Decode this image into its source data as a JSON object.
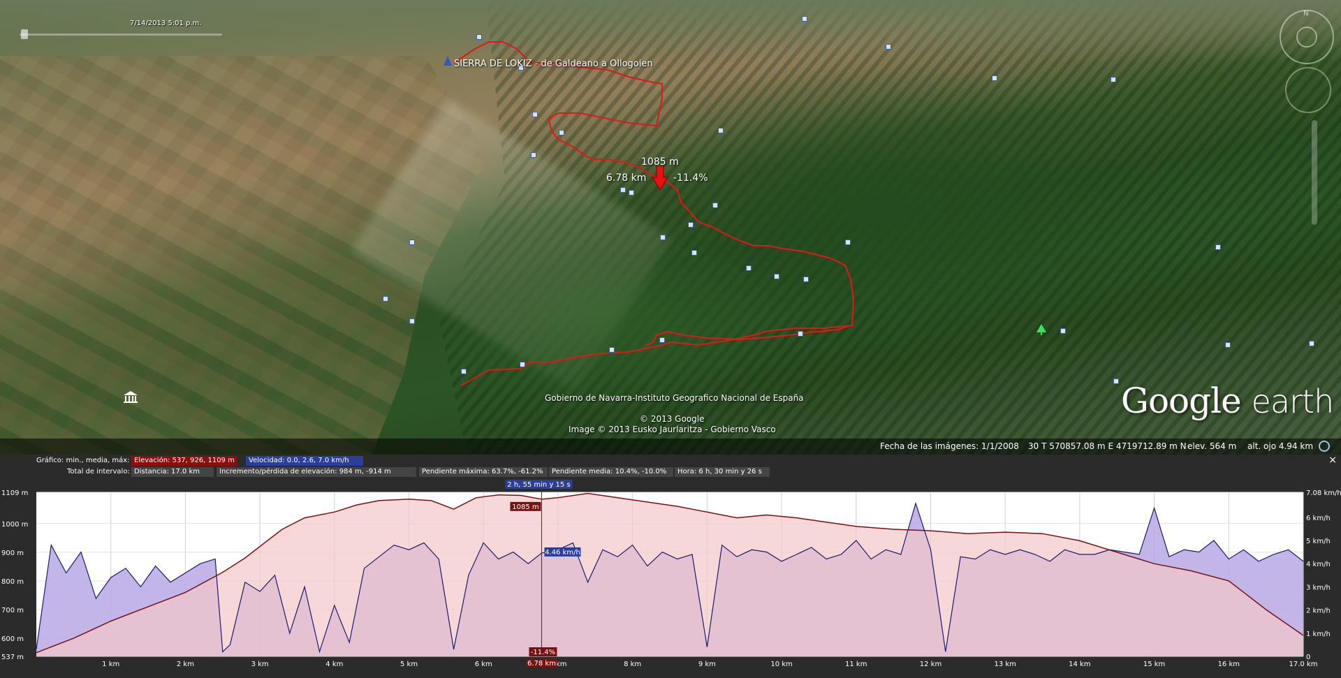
{
  "map": {
    "date_slider_label": "7/14/2013   5:01 p.m.",
    "track_title": "SIERRA DE LOKIZ - de Galdeano a Ollogoien",
    "hover": {
      "elevation": "1085 m",
      "distance": "6.78 km",
      "slope": "-11.4%"
    },
    "credits": {
      "line1": "Gobierno de Navarra-Instituto Geografico Nacional de España",
      "line2": "© 2013 Google",
      "line3": "Image © 2013 Eusko Jaurlaritza - Gobierno Vasco"
    },
    "logo": {
      "part1": "Google",
      "part2": "earth"
    },
    "nav_north": "N"
  },
  "status_bar": {
    "imagery_date": "Fecha de las imágenes: 1/1/2008",
    "coordinates": "30 T 570857.08 m E 4719712.89 m N",
    "elevation": "elev.   564 m",
    "eye_alt": "alt. ojo    4.94 km"
  },
  "profile": {
    "row1_label": "Gráfico: min., media, máx:",
    "elevation_stats": "Elevación: 537, 926, 1109 m",
    "speed_stats": "Velocidad: 0.0, 2.6, 7.0 km/h",
    "row2_label": "Total de intervalo:",
    "distance": "Distancia: 17.0 km",
    "gain_loss": "Incremento/pérdida de elevación: 984 m, -914 m",
    "max_slope": "Pendiente máxima: 63.7%, -61.2%",
    "avg_slope": "Pendiente media: 10.4%, -10.0%",
    "time": "Hora: 6 h, 30 min y 26 s",
    "close": "×"
  },
  "chart_data": {
    "type": "area",
    "x_unit": "km",
    "x_ticks": [
      "1 km",
      "2 km",
      "3 km",
      "4 km",
      "5 km",
      "6 km",
      "7 km",
      "8 km",
      "9 km",
      "10 km",
      "11 km",
      "12 km",
      "13 km",
      "14 km",
      "15 km",
      "16 km",
      "17.0 km"
    ],
    "x_tick_values": [
      1,
      2,
      3,
      4,
      5,
      6,
      7,
      8,
      9,
      10,
      11,
      12,
      13,
      14,
      15,
      16,
      17.0
    ],
    "xlim": [
      0,
      17.0
    ],
    "left_axis": {
      "ticks": [
        "537 m",
        "600 m",
        "700 m",
        "800 m",
        "900 m",
        "1000 m",
        "1109 m"
      ],
      "values": [
        537,
        600,
        700,
        800,
        900,
        1000,
        1109
      ],
      "ylim": [
        537,
        1109
      ]
    },
    "right_axis": {
      "ticks": [
        "0",
        "1 km/h",
        "2 km/h",
        "3 km/h",
        "4 km/h",
        "5 km/h",
        "6 km/h",
        "7.08 km/h"
      ],
      "values": [
        0,
        1,
        2,
        3,
        4,
        5,
        6,
        7.08
      ],
      "ylim": [
        0,
        7.08
      ]
    },
    "colors": {
      "elevation_line": "#7a1010",
      "elevation_fill": "#f4c8c8",
      "speed_line": "#1a1a6e",
      "speed_fill": "#b8a8e4"
    },
    "series": [
      {
        "name": "Elevación",
        "x": [
          0,
          0.5,
          1.0,
          1.5,
          2.0,
          2.5,
          2.8,
          3.0,
          3.3,
          3.6,
          4.0,
          4.3,
          4.6,
          5.0,
          5.3,
          5.6,
          5.9,
          6.2,
          6.5,
          6.78,
          7.0,
          7.4,
          7.8,
          8.2,
          8.6,
          9.0,
          9.4,
          9.8,
          10.2,
          10.6,
          11.0,
          11.5,
          12.0,
          12.5,
          13.0,
          13.5,
          14.0,
          14.5,
          15.0,
          15.5,
          16.0,
          16.5,
          17.0
        ],
        "y": [
          550,
          600,
          660,
          710,
          760,
          830,
          880,
          920,
          980,
          1020,
          1040,
          1065,
          1080,
          1085,
          1080,
          1050,
          1090,
          1100,
          1098,
          1085,
          1090,
          1105,
          1090,
          1075,
          1060,
          1040,
          1020,
          1030,
          1020,
          1005,
          990,
          980,
          975,
          965,
          970,
          965,
          940,
          900,
          860,
          835,
          800,
          700,
          610
        ]
      },
      {
        "name": "Velocidad",
        "x": [
          0,
          0.2,
          0.4,
          0.6,
          0.8,
          1.0,
          1.2,
          1.4,
          1.6,
          1.8,
          2.0,
          2.2,
          2.4,
          2.5,
          2.6,
          2.8,
          3.0,
          3.2,
          3.4,
          3.6,
          3.8,
          4.0,
          4.2,
          4.4,
          4.6,
          4.8,
          5.0,
          5.2,
          5.4,
          5.6,
          5.8,
          6.0,
          6.2,
          6.4,
          6.6,
          6.78,
          7.0,
          7.2,
          7.4,
          7.6,
          7.8,
          8.0,
          8.2,
          8.4,
          8.6,
          8.8,
          9.0,
          9.2,
          9.4,
          9.6,
          9.8,
          10.0,
          10.2,
          10.4,
          10.6,
          10.8,
          11.0,
          11.2,
          11.4,
          11.6,
          11.8,
          12.0,
          12.2,
          12.4,
          12.6,
          12.8,
          13.0,
          13.2,
          13.4,
          13.6,
          13.8,
          14.0,
          14.2,
          14.4,
          14.6,
          14.8,
          15.0,
          15.2,
          15.4,
          15.6,
          15.8,
          16.0,
          16.2,
          16.4,
          16.6,
          16.8,
          17.0
        ],
        "y": [
          0.3,
          4.8,
          3.6,
          4.5,
          2.5,
          3.4,
          3.8,
          3.0,
          3.9,
          3.2,
          3.6,
          4.0,
          4.2,
          0.2,
          0.5,
          3.2,
          2.8,
          3.5,
          1.0,
          3.0,
          0.2,
          2.2,
          0.6,
          3.8,
          4.3,
          4.8,
          4.6,
          4.9,
          4.2,
          0.3,
          3.5,
          4.9,
          4.2,
          4.5,
          4.0,
          4.46,
          4.6,
          4.9,
          3.2,
          4.6,
          4.3,
          4.8,
          3.9,
          4.5,
          4.2,
          4.4,
          0.4,
          4.8,
          4.3,
          4.6,
          4.5,
          4.1,
          4.4,
          4.7,
          4.2,
          4.4,
          5.0,
          4.2,
          4.6,
          4.4,
          6.6,
          4.6,
          0.2,
          4.3,
          4.2,
          4.6,
          4.4,
          4.6,
          4.4,
          4.1,
          4.6,
          4.4,
          4.4,
          4.6,
          4.5,
          4.4,
          6.4,
          4.3,
          4.6,
          4.5,
          5.0,
          4.2,
          4.6,
          4.1,
          4.4,
          4.6,
          4.1
        ]
      }
    ],
    "cursor": {
      "x": 6.78,
      "x_label": "6.78 km",
      "elevation_label": "1085 m",
      "speed_label": "4.46 km/h",
      "time_label": "2 h, 55 min y 15 s",
      "slope_label": "-11.4%"
    }
  }
}
